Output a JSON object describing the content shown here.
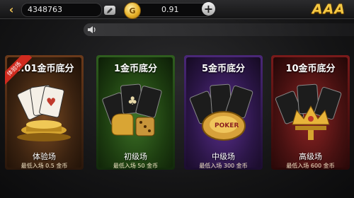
{
  "header": {
    "back_icon": "back-arrow-icon",
    "user_id": "4348763",
    "edit_icon": "edit-pencil-icon",
    "coin_icon": "gold-coin-icon",
    "coin_symbol": "G",
    "balance": "0.91",
    "add_icon": "plus-icon",
    "add_label": "+",
    "brand": "AAA"
  },
  "notice": {
    "icon": "speaker-icon"
  },
  "rooms": [
    {
      "title": "0.01金币底分",
      "name": "体验场",
      "min_entry": "最低入场 0.5 金币",
      "badge": "体验场",
      "theme": "#d07a2e"
    },
    {
      "title": "1金币底分",
      "name": "初级场",
      "min_entry": "最低入场 50 金币",
      "theme": "#3f8a2a"
    },
    {
      "title": "5金币底分",
      "name": "中级场",
      "min_entry": "最低入场 300 金币",
      "theme": "#5a2a8a"
    },
    {
      "title": "10金币底分",
      "name": "高级场",
      "min_entry": "最低入场 600 金币",
      "theme": "#8a1e1e"
    }
  ]
}
